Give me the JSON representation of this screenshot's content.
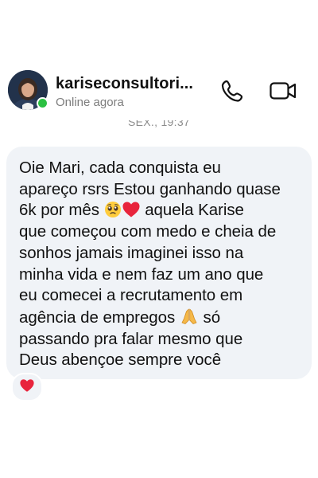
{
  "header": {
    "contact_name": "kariseconsultori...",
    "status": "Online agora"
  },
  "conversation": {
    "timestamp": "SEX., 19:37",
    "message": {
      "line1": "Oie Mari, cada conquista eu",
      "line2": "apareço rsrs Estou ganhando quase",
      "line3_a": "6k por mês ",
      "line3_b": " aquela Karise",
      "line4": "que começou com medo e cheia de",
      "line5": "sonhos jamais imaginei isso na",
      "line6": "minha vida e nem faz um ano que",
      "line7": "eu comecei a recrutamento em",
      "line8_a": "agência de empregos ",
      "line8_b": " só",
      "line9": "passando pra falar mesmo que",
      "line10": "Deus abençoe sempre você"
    },
    "reaction_icon": "red-heart-icon"
  },
  "colors": {
    "online_dot": "#2bc042",
    "bubble_background": "#f0f3f7",
    "heart": "#e8243c"
  },
  "icons": {
    "call": "phone-icon",
    "video": "video-camera-icon",
    "emoji_1": "pleading-face-emoji",
    "emoji_2": "red-heart-emoji",
    "emoji_3": "folded-hands-emoji"
  }
}
